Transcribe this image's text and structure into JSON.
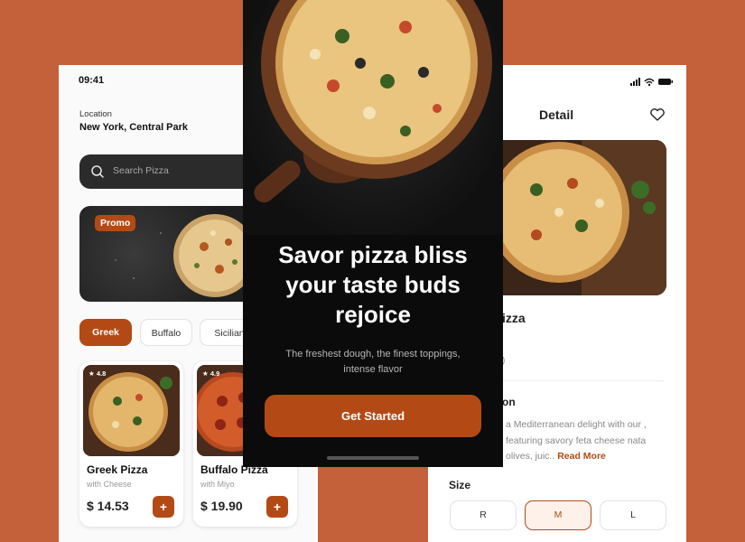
{
  "colors": {
    "background": "#C4613A",
    "accent": "#B34A15",
    "dark": "#0b0b0b"
  },
  "home": {
    "time": "09:41",
    "location_label": "Location",
    "location_value": "New York, Central Park",
    "search_placeholder": "Search Pizza",
    "promo_badge": "Promo",
    "categories": [
      {
        "label": "Greek",
        "active": true
      },
      {
        "label": "Buffalo",
        "active": false
      },
      {
        "label": "Sicilian",
        "active": false
      }
    ],
    "products": [
      {
        "rating": "4.8",
        "name": "Greek Pizza",
        "subtitle": "with Cheese",
        "price": "$ 14.53",
        "add_label": "+"
      },
      {
        "rating": "4.9",
        "name": "Buffalo Pizza",
        "subtitle": "with Miyo",
        "price": "$ 19.90",
        "add_label": "+"
      }
    ]
  },
  "onboarding": {
    "headline_line1": "Savor pizza bliss",
    "headline_line2": "your taste buds",
    "headline_line3": "rejoice",
    "subline": "The freshest dough, the finest toppings, intense flavor",
    "cta_label": "Get Started"
  },
  "detail": {
    "title": "Detail",
    "name_partial": "izza",
    "rating_partial": ")",
    "description_title_partial": "on",
    "description_partial": "a Mediterranean delight with our , featuring savory feta cheese nata olives, juic..",
    "read_more": "Read More",
    "size_label": "Size",
    "sizes": [
      {
        "label": "R",
        "selected": false
      },
      {
        "label": "M",
        "selected": true
      },
      {
        "label": "L",
        "selected": false
      }
    ]
  }
}
